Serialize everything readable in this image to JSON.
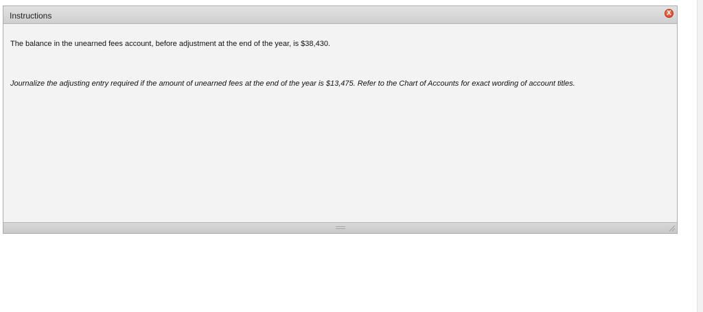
{
  "panel": {
    "title": "Instructions",
    "close_label": "X"
  },
  "body": {
    "paragraph_1": "The balance in the unearned fees account, before adjustment at the end of the year, is $38,430.",
    "paragraph_2": "Journalize the adjusting entry required if the amount of unearned fees at the end of the year is $13,475. Refer to the Chart of Accounts for exact wording of account titles."
  },
  "icons": {
    "close": "close-icon",
    "drag": "drag-handle-icon",
    "resize": "resize-grip-icon"
  },
  "colors": {
    "close_button": "#d63b1f",
    "panel_background": "#f2f3f2",
    "header_background": "#d8d8d8"
  }
}
